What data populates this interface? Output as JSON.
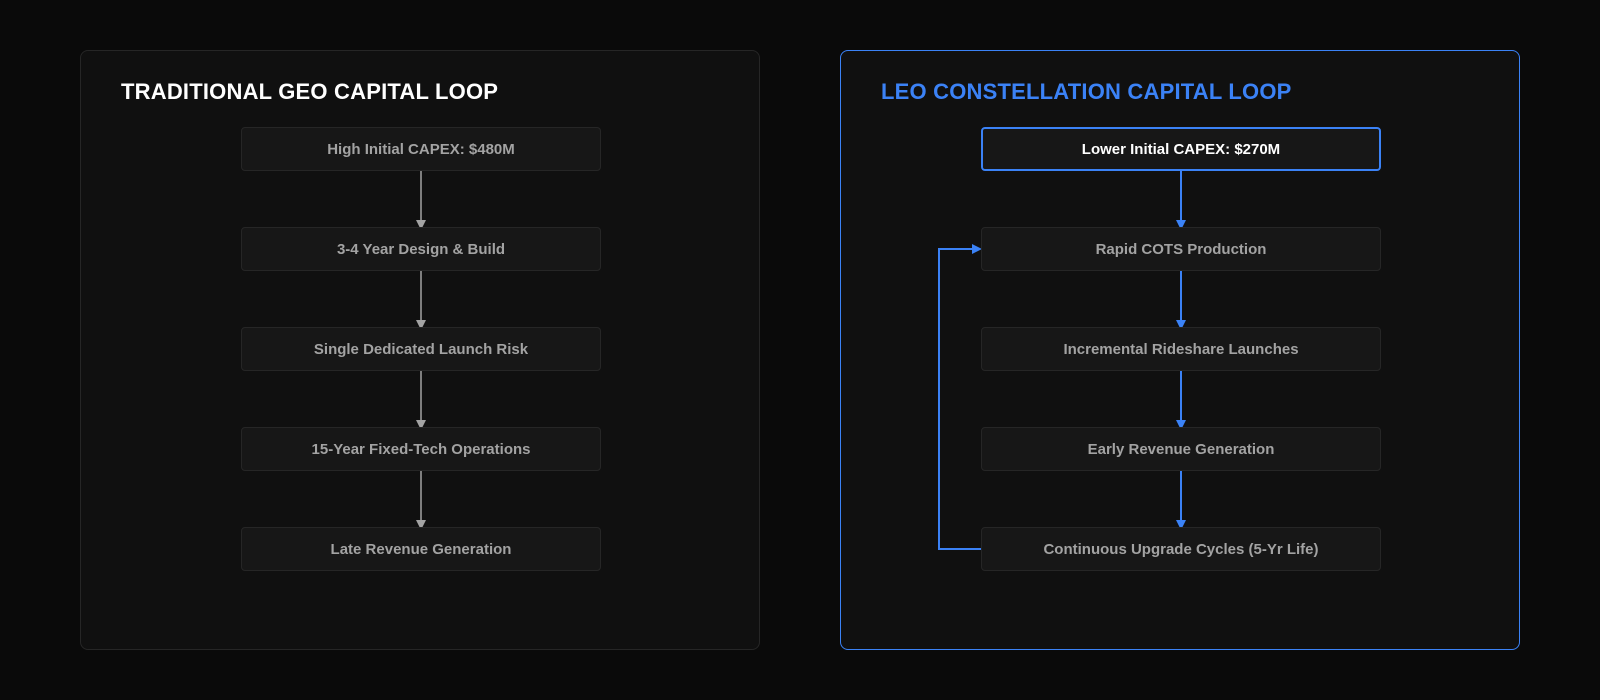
{
  "left": {
    "title": "TRADITIONAL GEO CAPITAL LOOP",
    "steps": [
      "High Initial CAPEX: $480M",
      "3-4 Year Design & Build",
      "Single Dedicated Launch Risk",
      "15-Year Fixed-Tech Operations",
      "Late Revenue Generation"
    ]
  },
  "right": {
    "title": "LEO CONSTELLATION CAPITAL LOOP",
    "steps": [
      "Lower Initial CAPEX: $270M",
      "Rapid COTS Production",
      "Incremental Rideshare Launches",
      "Early Revenue Generation",
      "Continuous Upgrade Cycles (5-Yr Life)"
    ]
  },
  "colors": {
    "accent": "#3b82f6",
    "grey_arrow": "#a3a3a3",
    "background": "#0a0a0a",
    "panel": "#101010",
    "node": "#171717"
  }
}
